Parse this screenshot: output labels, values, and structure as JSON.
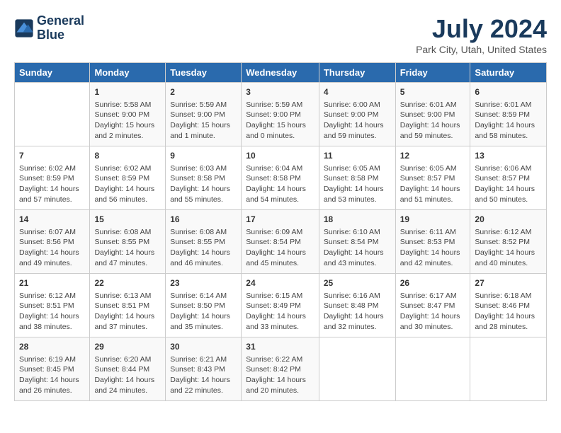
{
  "header": {
    "logo_line1": "General",
    "logo_line2": "Blue",
    "month": "July 2024",
    "location": "Park City, Utah, United States"
  },
  "days_of_week": [
    "Sunday",
    "Monday",
    "Tuesday",
    "Wednesday",
    "Thursday",
    "Friday",
    "Saturday"
  ],
  "weeks": [
    [
      {
        "day": "",
        "info": ""
      },
      {
        "day": "1",
        "info": "Sunrise: 5:58 AM\nSunset: 9:00 PM\nDaylight: 15 hours\nand 2 minutes."
      },
      {
        "day": "2",
        "info": "Sunrise: 5:59 AM\nSunset: 9:00 PM\nDaylight: 15 hours\nand 1 minute."
      },
      {
        "day": "3",
        "info": "Sunrise: 5:59 AM\nSunset: 9:00 PM\nDaylight: 15 hours\nand 0 minutes."
      },
      {
        "day": "4",
        "info": "Sunrise: 6:00 AM\nSunset: 9:00 PM\nDaylight: 14 hours\nand 59 minutes."
      },
      {
        "day": "5",
        "info": "Sunrise: 6:01 AM\nSunset: 9:00 PM\nDaylight: 14 hours\nand 59 minutes."
      },
      {
        "day": "6",
        "info": "Sunrise: 6:01 AM\nSunset: 8:59 PM\nDaylight: 14 hours\nand 58 minutes."
      }
    ],
    [
      {
        "day": "7",
        "info": "Sunrise: 6:02 AM\nSunset: 8:59 PM\nDaylight: 14 hours\nand 57 minutes."
      },
      {
        "day": "8",
        "info": "Sunrise: 6:02 AM\nSunset: 8:59 PM\nDaylight: 14 hours\nand 56 minutes."
      },
      {
        "day": "9",
        "info": "Sunrise: 6:03 AM\nSunset: 8:58 PM\nDaylight: 14 hours\nand 55 minutes."
      },
      {
        "day": "10",
        "info": "Sunrise: 6:04 AM\nSunset: 8:58 PM\nDaylight: 14 hours\nand 54 minutes."
      },
      {
        "day": "11",
        "info": "Sunrise: 6:05 AM\nSunset: 8:58 PM\nDaylight: 14 hours\nand 53 minutes."
      },
      {
        "day": "12",
        "info": "Sunrise: 6:05 AM\nSunset: 8:57 PM\nDaylight: 14 hours\nand 51 minutes."
      },
      {
        "day": "13",
        "info": "Sunrise: 6:06 AM\nSunset: 8:57 PM\nDaylight: 14 hours\nand 50 minutes."
      }
    ],
    [
      {
        "day": "14",
        "info": "Sunrise: 6:07 AM\nSunset: 8:56 PM\nDaylight: 14 hours\nand 49 minutes."
      },
      {
        "day": "15",
        "info": "Sunrise: 6:08 AM\nSunset: 8:55 PM\nDaylight: 14 hours\nand 47 minutes."
      },
      {
        "day": "16",
        "info": "Sunrise: 6:08 AM\nSunset: 8:55 PM\nDaylight: 14 hours\nand 46 minutes."
      },
      {
        "day": "17",
        "info": "Sunrise: 6:09 AM\nSunset: 8:54 PM\nDaylight: 14 hours\nand 45 minutes."
      },
      {
        "day": "18",
        "info": "Sunrise: 6:10 AM\nSunset: 8:54 PM\nDaylight: 14 hours\nand 43 minutes."
      },
      {
        "day": "19",
        "info": "Sunrise: 6:11 AM\nSunset: 8:53 PM\nDaylight: 14 hours\nand 42 minutes."
      },
      {
        "day": "20",
        "info": "Sunrise: 6:12 AM\nSunset: 8:52 PM\nDaylight: 14 hours\nand 40 minutes."
      }
    ],
    [
      {
        "day": "21",
        "info": "Sunrise: 6:12 AM\nSunset: 8:51 PM\nDaylight: 14 hours\nand 38 minutes."
      },
      {
        "day": "22",
        "info": "Sunrise: 6:13 AM\nSunset: 8:51 PM\nDaylight: 14 hours\nand 37 minutes."
      },
      {
        "day": "23",
        "info": "Sunrise: 6:14 AM\nSunset: 8:50 PM\nDaylight: 14 hours\nand 35 minutes."
      },
      {
        "day": "24",
        "info": "Sunrise: 6:15 AM\nSunset: 8:49 PM\nDaylight: 14 hours\nand 33 minutes."
      },
      {
        "day": "25",
        "info": "Sunrise: 6:16 AM\nSunset: 8:48 PM\nDaylight: 14 hours\nand 32 minutes."
      },
      {
        "day": "26",
        "info": "Sunrise: 6:17 AM\nSunset: 8:47 PM\nDaylight: 14 hours\nand 30 minutes."
      },
      {
        "day": "27",
        "info": "Sunrise: 6:18 AM\nSunset: 8:46 PM\nDaylight: 14 hours\nand 28 minutes."
      }
    ],
    [
      {
        "day": "28",
        "info": "Sunrise: 6:19 AM\nSunset: 8:45 PM\nDaylight: 14 hours\nand 26 minutes."
      },
      {
        "day": "29",
        "info": "Sunrise: 6:20 AM\nSunset: 8:44 PM\nDaylight: 14 hours\nand 24 minutes."
      },
      {
        "day": "30",
        "info": "Sunrise: 6:21 AM\nSunset: 8:43 PM\nDaylight: 14 hours\nand 22 minutes."
      },
      {
        "day": "31",
        "info": "Sunrise: 6:22 AM\nSunset: 8:42 PM\nDaylight: 14 hours\nand 20 minutes."
      },
      {
        "day": "",
        "info": ""
      },
      {
        "day": "",
        "info": ""
      },
      {
        "day": "",
        "info": ""
      }
    ]
  ]
}
